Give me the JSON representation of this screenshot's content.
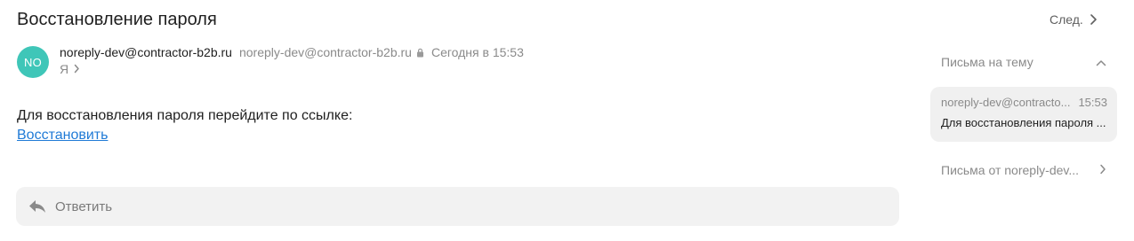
{
  "message": {
    "subject": "Восстановление пароля",
    "sender_name": "noreply-dev@contractor-b2b.ru",
    "sender_email": "noreply-dev@contractor-b2b.ru",
    "date": "Сегодня в 15:53",
    "recipient": "Я",
    "avatar_initials": "NO",
    "body_text": "Для восстановления пароля перейдите по ссылке:",
    "link_text": "Восстановить"
  },
  "toolbar": {
    "next_label": "След."
  },
  "reply": {
    "label": "Ответить"
  },
  "sidebar": {
    "thread_title": "Письма на тему",
    "thread_item": {
      "from": "noreply-dev@contracto...",
      "time": "15:53",
      "preview": "Для восстановления пароля ..."
    },
    "from_sender_label": "Письма от noreply-dev..."
  },
  "colors": {
    "avatar": "#3fc6b8",
    "link": "#1f7ad6",
    "muted": "#8a8a8a"
  },
  "icons": [
    "chevron-right-icon",
    "lock-icon",
    "reply-arrow-icon",
    "chevron-up-icon"
  ]
}
